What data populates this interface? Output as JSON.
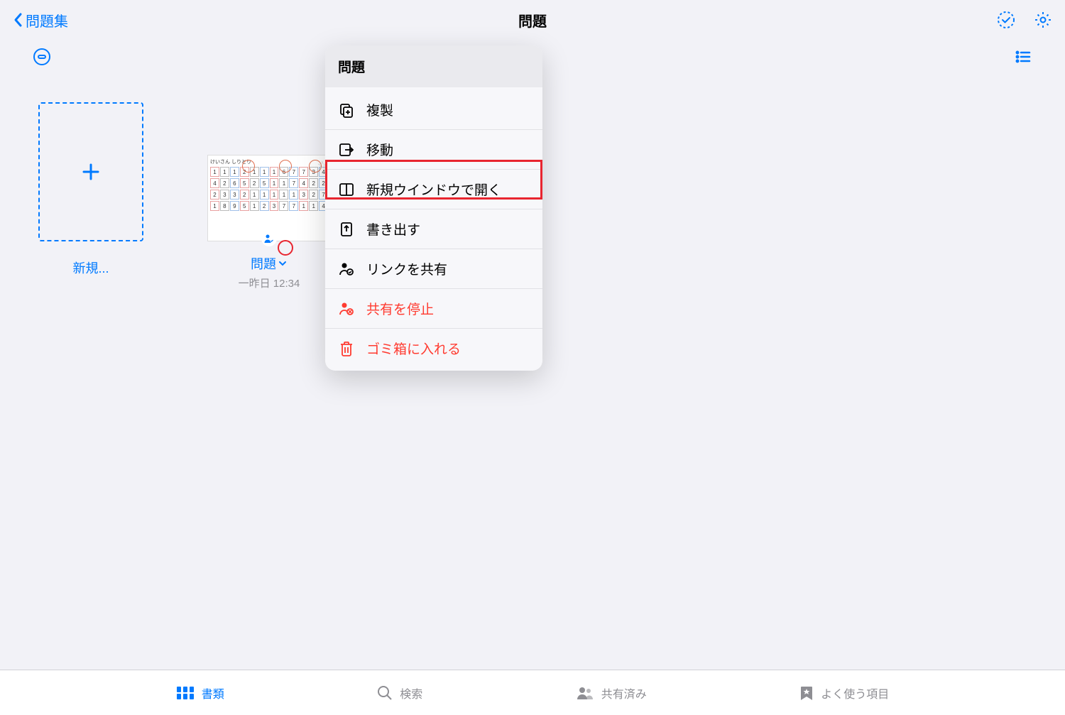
{
  "nav": {
    "back_label": "問題集",
    "title": "問題"
  },
  "grid": {
    "new_label": "新規...",
    "doc": {
      "name": "問題",
      "date": "一昨日 12:34",
      "thumb_title": "けいさん しりとり"
    }
  },
  "menu": {
    "title": "問題",
    "duplicate": "複製",
    "move": "移動",
    "new_window": "新規ウインドウで開く",
    "export": "書き出す",
    "share_link": "リンクを共有",
    "stop_share": "共有を停止",
    "trash": "ゴミ箱に入れる"
  },
  "tabs": {
    "documents": "書類",
    "search": "検索",
    "shared": "共有済み",
    "favorites": "よく使う項目"
  }
}
